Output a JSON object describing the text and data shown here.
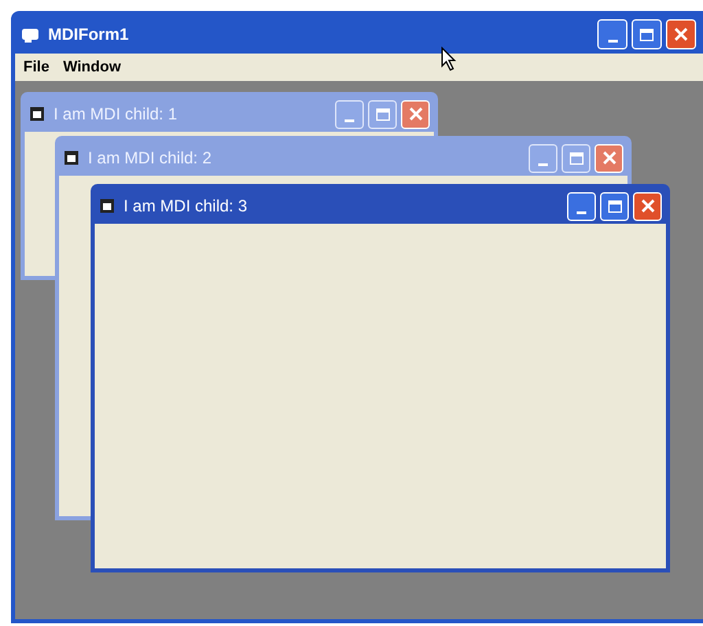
{
  "window": {
    "title": "MDIForm1"
  },
  "menu": [
    {
      "label": "File"
    },
    {
      "label": "Window"
    }
  ],
  "children": [
    {
      "title": "I am MDI child: 1",
      "active": false
    },
    {
      "title": "I am MDI child: 2",
      "active": false
    },
    {
      "title": "I am MDI child: 3",
      "active": true
    }
  ]
}
